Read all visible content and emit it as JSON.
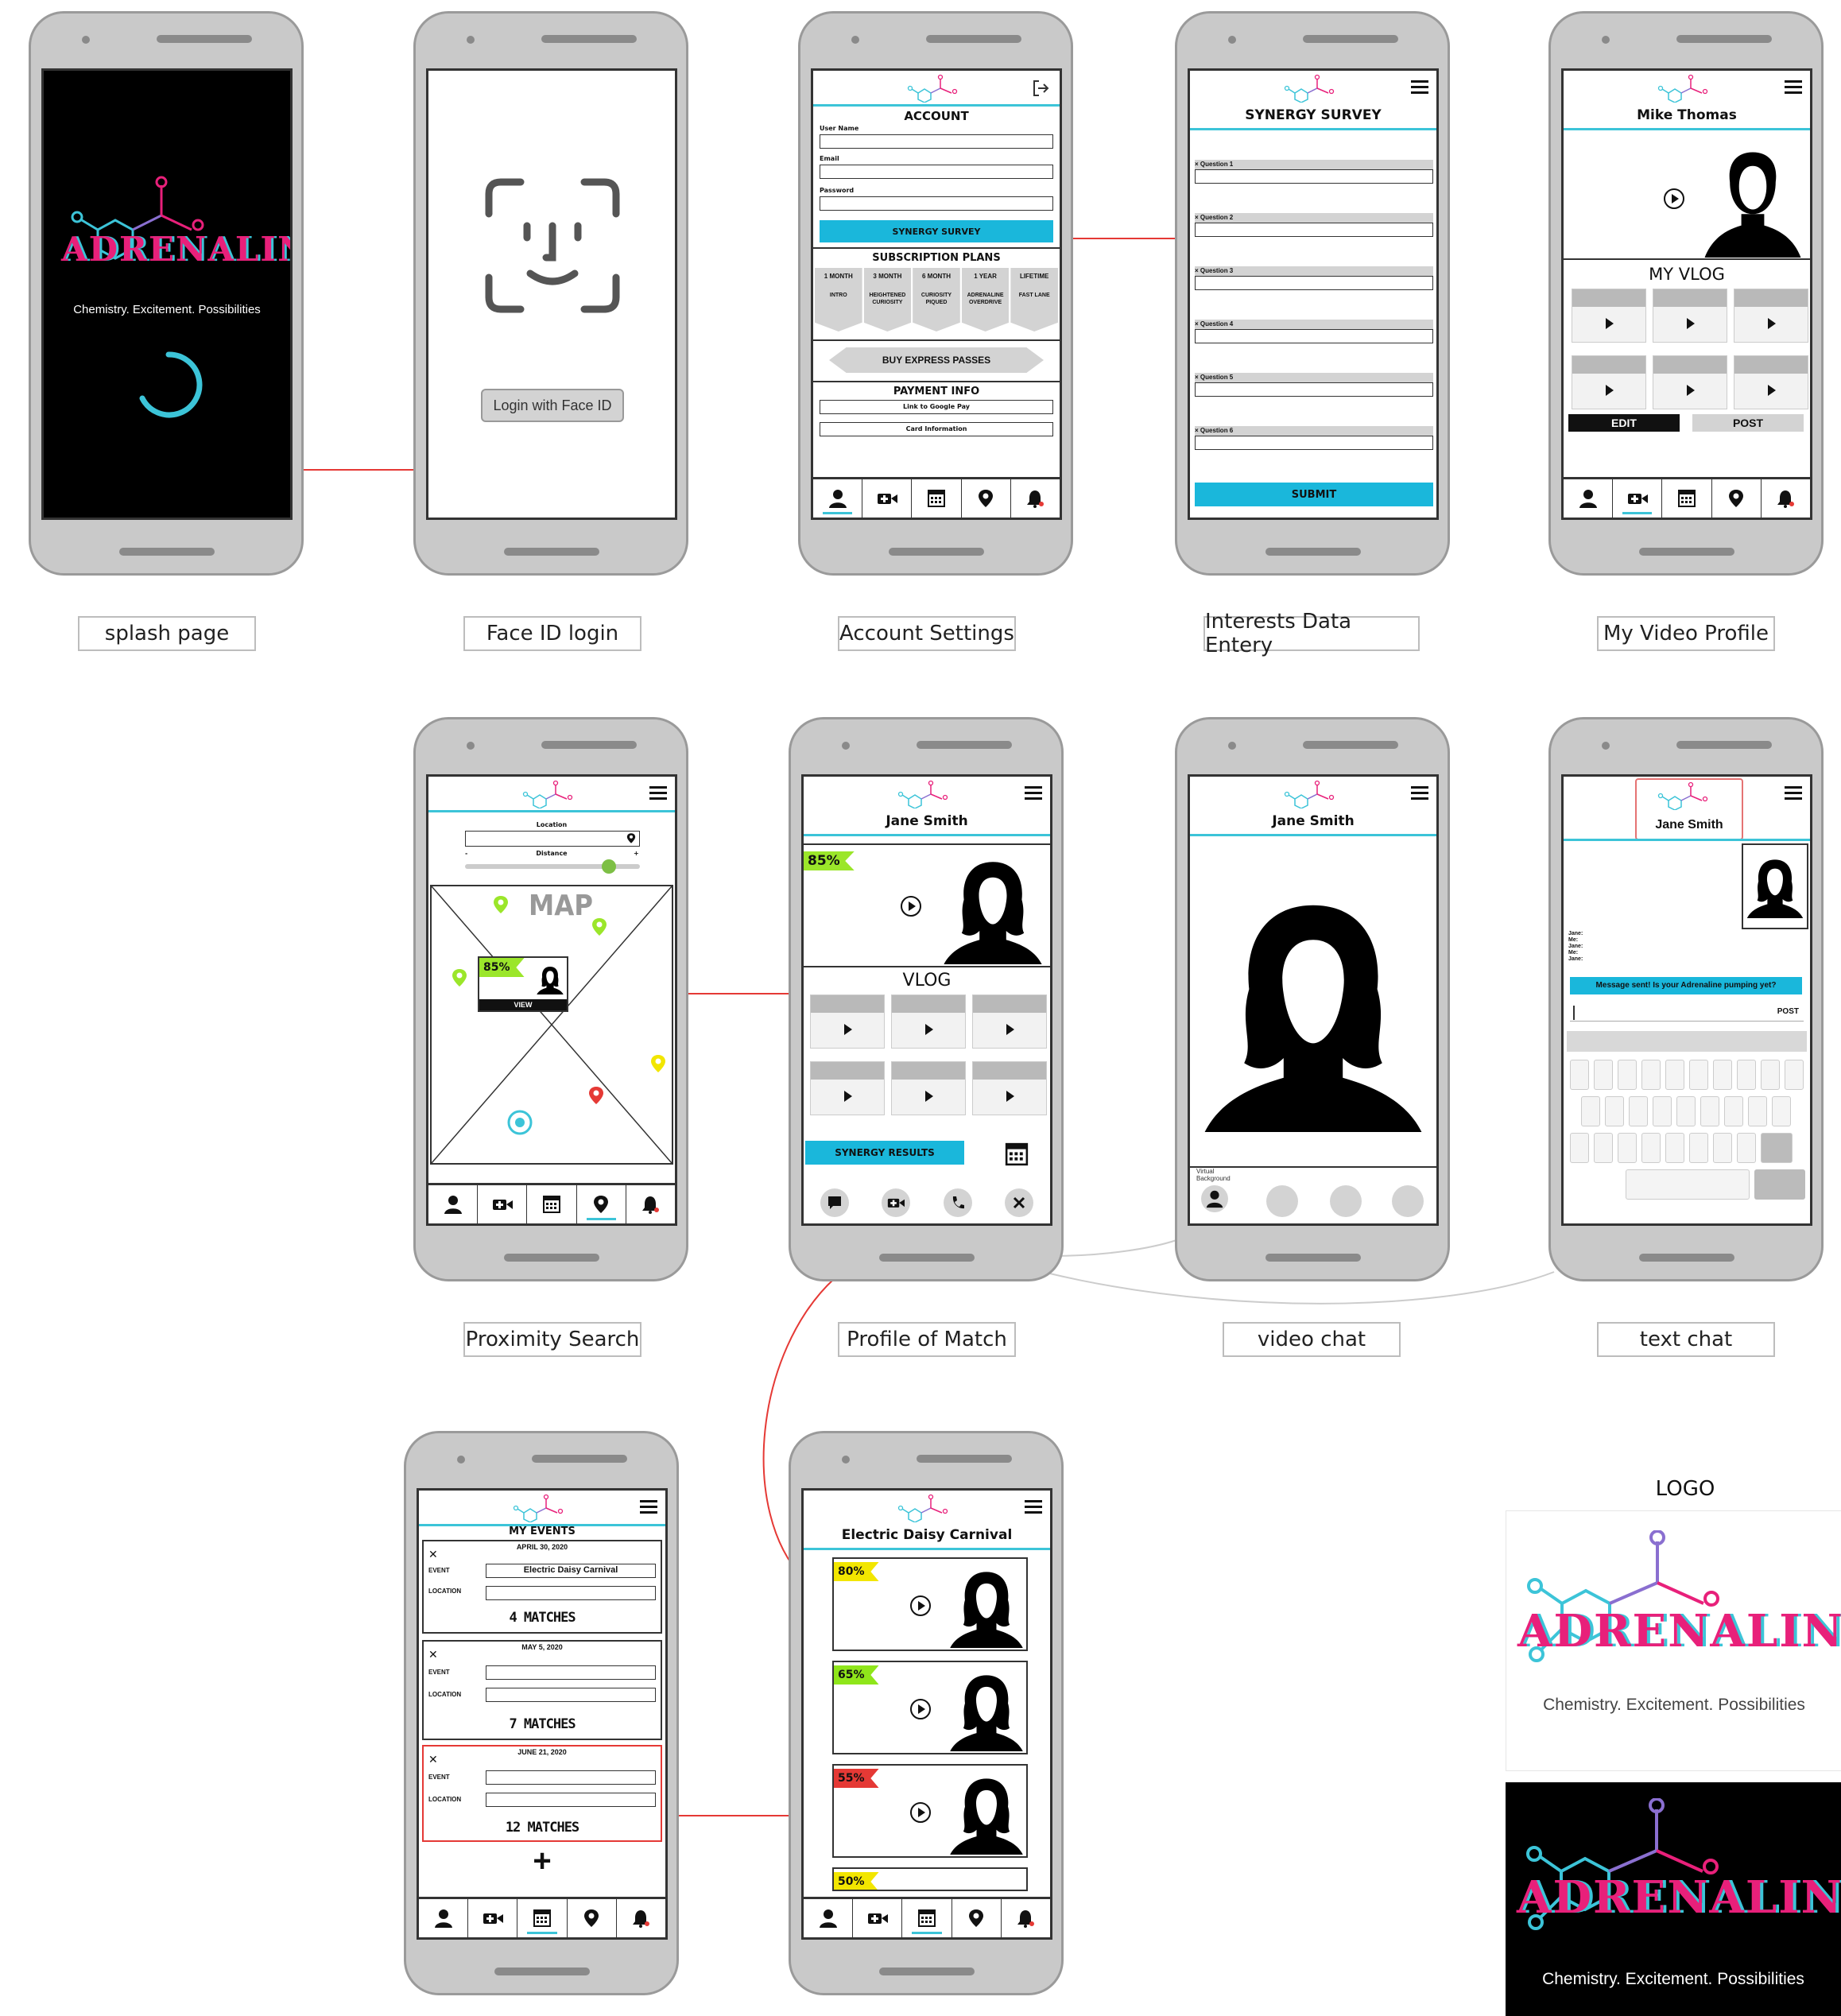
{
  "screens": {
    "splash": {
      "caption": "splash page",
      "logo_text": "ADRENALINE",
      "tagline": "Chemistry. Excitement. Possibilities"
    },
    "faceid": {
      "caption": "Face ID login",
      "login_button": "Login with Face ID"
    },
    "account": {
      "caption": "Account Settings",
      "title": "ACCOUNT",
      "username_label": "User Name",
      "email_label": "Email",
      "password_label": "Password",
      "survey_button": "SYNERGY SURVEY",
      "plans_title": "SUBSCRIPTION PLANS",
      "plans": [
        {
          "term": "1 MONTH",
          "name": "INTRO"
        },
        {
          "term": "3 MONTH",
          "name": "HEIGHTENED CURIOSITY"
        },
        {
          "term": "6 MONTH",
          "name": "CURIOSITY PIQUED"
        },
        {
          "term": "1 YEAR",
          "name": "ADRENALINE OVERDRIVE"
        },
        {
          "term": "LIFETIME",
          "name": "FAST LANE"
        }
      ],
      "express_button": "BUY EXPRESS PASSES",
      "payment_title": "PAYMENT INFO",
      "google_pay": "Link to Google Pay",
      "card_info": "Card Information"
    },
    "survey": {
      "caption": "Interests Data Entery",
      "title": "SYNERGY SURVEY",
      "questions": [
        "Question 1",
        "Question 2",
        "Question 3",
        "Question 4",
        "Question 5",
        "Question 6"
      ],
      "submit": "SUBMIT"
    },
    "myvideo": {
      "caption": "My Video Profile",
      "name": "Mike Thomas",
      "vlog_title": "MY VLOG",
      "edit": "EDIT",
      "post": "POST"
    },
    "proximity": {
      "caption": "Proximity Search",
      "location_label": "Location",
      "distance_label": "Distance",
      "minus": "-",
      "plus": "+",
      "map_label": "MAP",
      "match_percent": "85%",
      "view": "VIEW"
    },
    "profile": {
      "caption": "Profile of Match",
      "name": "Jane Smith",
      "match_percent": "85%",
      "vlog_title": "VLOG",
      "synergy_button": "SYNERGY RESULTS"
    },
    "videochat": {
      "caption": "video chat",
      "name": "Jane Smith",
      "virtual_bg": "Virtual Background"
    },
    "textchat": {
      "caption": "text chat",
      "name": "Jane Smith",
      "chat_lines": [
        "Jane:",
        "Me:",
        "Jane:",
        "Me:",
        "Jane:"
      ],
      "message": "Message sent! Is your Adrenaline pumping yet?",
      "post": "POST"
    },
    "events": {
      "title": "MY EVENTS",
      "event_label": "EVENT",
      "location_label": "LOCATION",
      "cards": [
        {
          "date": "APRIL 30, 2020",
          "event": "Electric Daisy Carnival",
          "matches": "4 MATCHES"
        },
        {
          "date": "MAY 5, 2020",
          "event": "",
          "matches": "7 MATCHES"
        },
        {
          "date": "JUNE 21, 2020",
          "event": "",
          "matches": "12 MATCHES"
        }
      ],
      "add": "+"
    },
    "eventmatches": {
      "title": "Electric Daisy Carnival",
      "matches": [
        {
          "percent": "80%",
          "color": "#f2e600"
        },
        {
          "percent": "65%",
          "color": "#8fe61a"
        },
        {
          "percent": "55%",
          "color": "#e53935"
        },
        {
          "percent": "50%",
          "color": "#f2e600"
        }
      ]
    }
  },
  "logo_panel": {
    "title": "LOGO",
    "logo_text": "ADRENALINE",
    "tagline": "Chemistry. Excitement. Possibilities"
  },
  "colors": {
    "accent_cyan": "#1ab7db",
    "connector_red": "#e53935",
    "logo_pink": "#e8207a",
    "logo_blue": "#3cc4d8"
  },
  "icons": [
    "user-icon",
    "video-add-icon",
    "calendar-icon",
    "location-pin-icon",
    "bell-icon",
    "logout-icon",
    "menu-icon",
    "play-icon",
    "chat-icon",
    "phone-icon",
    "close-icon",
    "face-id-icon",
    "loading-spinner-icon"
  ]
}
